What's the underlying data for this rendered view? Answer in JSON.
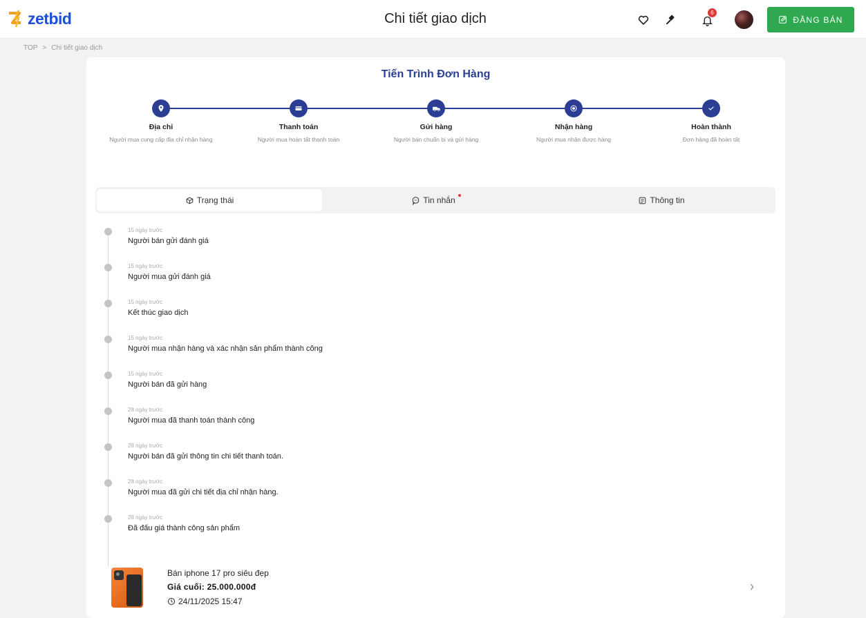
{
  "header": {
    "logo_text": "zetbid",
    "title": "Chi tiết giao dịch",
    "notification_count": "6",
    "post_button_label": "ĐĂNG BÁN",
    "icons": [
      "heart-icon",
      "gavel-icon",
      "bell-icon",
      "avatar",
      "edit-icon"
    ]
  },
  "breadcrumb": {
    "home": "TOP",
    "separator": ">",
    "current": "Chi tiết giao dịch"
  },
  "progress": {
    "title": "Tiến Trình Đơn Hàng",
    "steps": [
      {
        "name": "Địa chỉ",
        "desc": "Người mua cung cấp địa chỉ nhận hàng",
        "icon": "location-pin-icon"
      },
      {
        "name": "Thanh toán",
        "desc": "Người mua hoàn tất thanh toán",
        "icon": "card-icon"
      },
      {
        "name": "Gửi hàng",
        "desc": "Người bán chuẩn bị và gửi hàng",
        "icon": "truck-icon"
      },
      {
        "name": "Nhận hàng",
        "desc": "Người mua nhận được hàng",
        "icon": "box-icon"
      },
      {
        "name": "Hoàn thành",
        "desc": "Đơn hàng đã hoàn tất",
        "icon": "check-icon"
      }
    ]
  },
  "tabs": [
    {
      "label": "Trạng thái",
      "icon": "status-icon",
      "active": true
    },
    {
      "label": "Tin nhắn",
      "icon": "chat-icon",
      "active": false
    },
    {
      "label": "Thông tin",
      "icon": "info-icon",
      "active": false
    }
  ],
  "timeline": [
    {
      "time": "15 ngày trước",
      "text": "Người bán gửi đánh giá"
    },
    {
      "time": "15 ngày trước",
      "text": "Người mua gửi đánh giá"
    },
    {
      "time": "15 ngày trước",
      "text": "Kết thúc giao dịch"
    },
    {
      "time": "15 ngày trước",
      "text": "Người mua nhận hàng và xác nhận sản phẩm thành công"
    },
    {
      "time": "15 ngày trước",
      "text": "Người bán đã gửi hàng"
    },
    {
      "time": "28 ngày trước",
      "text": "Người mua đã thanh toán thành công"
    },
    {
      "time": "28 ngày trước",
      "text": "Người bán đã gửi thông tin chi tiết thanh toán."
    },
    {
      "time": "28 ngày trước",
      "text": "Người mua đã gửi chi tiết địa chỉ nhận hàng."
    },
    {
      "time": "28 ngày trước",
      "text": "Đã đấu giá thành công sản phẩm"
    }
  ],
  "product": {
    "name": "Bán iphone 17 pro siêu đẹp",
    "price": "Giá cuối:  25.000.000đ",
    "date": "24/11/2025 15:47"
  },
  "colors": {
    "brand_blue": "#1d4fd8",
    "step_navy": "#2c3e94",
    "post_green": "#2fa84f",
    "badge_red": "#e23a3a"
  }
}
